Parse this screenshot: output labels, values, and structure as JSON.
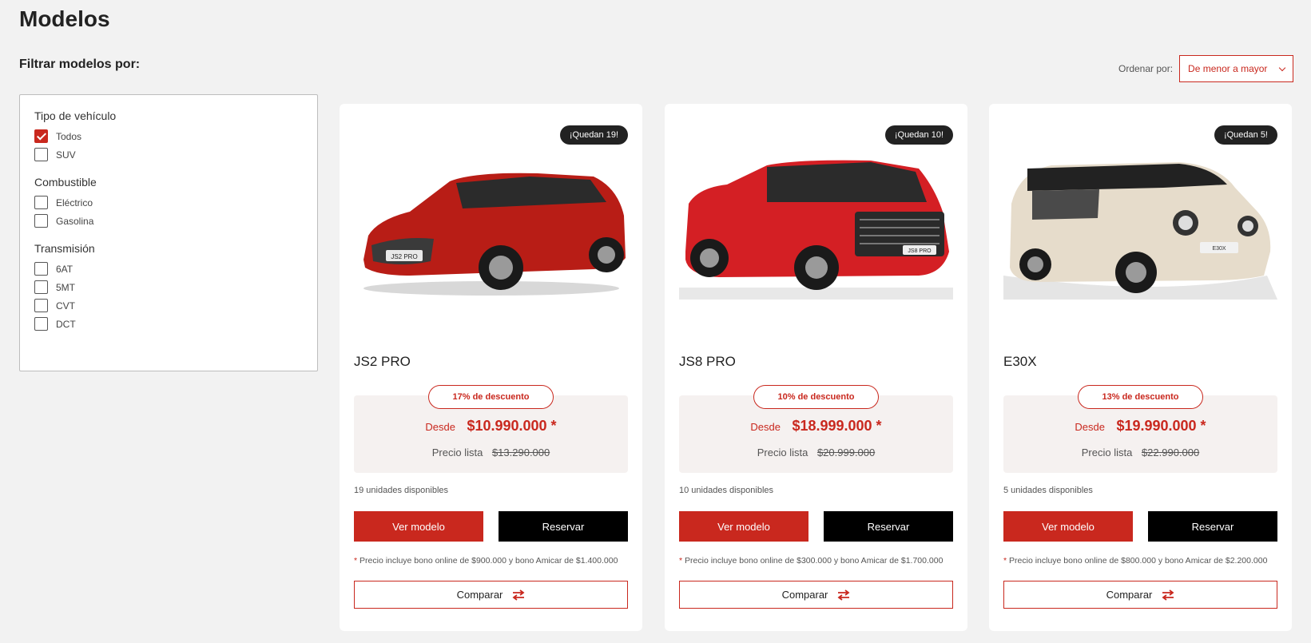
{
  "page": {
    "title": "Modelos",
    "filter_title": "Filtrar modelos por:"
  },
  "sort": {
    "label": "Ordenar por:",
    "value": "De menor a mayor"
  },
  "filters": [
    {
      "title": "Tipo de vehículo",
      "options": [
        {
          "label": "Todos",
          "checked": true
        },
        {
          "label": "SUV",
          "checked": false
        }
      ]
    },
    {
      "title": "Combustible",
      "options": [
        {
          "label": "Eléctrico",
          "checked": false
        },
        {
          "label": "Gasolina",
          "checked": false
        }
      ]
    },
    {
      "title": "Transmisión",
      "options": [
        {
          "label": "6AT",
          "checked": false
        },
        {
          "label": "5MT",
          "checked": false
        },
        {
          "label": "CVT",
          "checked": false
        },
        {
          "label": "DCT",
          "checked": false
        }
      ]
    }
  ],
  "cards": [
    {
      "badge": "¡Quedan 19!",
      "name": "JS2 PRO",
      "discount": "17% de descuento",
      "desde": "Desde",
      "price": "$10.990.000 *",
      "lista_label": "Precio lista",
      "lista": "$13.290.000",
      "units": "19 unidades disponibles",
      "ver": "Ver modelo",
      "reservar": "Reservar",
      "note": "Precio incluye bono online de $900.000 y bono Amicar de $1.400.000",
      "compare": "Comparar",
      "plate": "JS2 PRO"
    },
    {
      "badge": "¡Quedan 10!",
      "name": "JS8 PRO",
      "discount": "10% de descuento",
      "desde": "Desde",
      "price": "$18.999.000 *",
      "lista_label": "Precio lista",
      "lista": "$20.999.000",
      "units": "10 unidades disponibles",
      "ver": "Ver modelo",
      "reservar": "Reservar",
      "note": "Precio incluye bono online de $300.000 y bono Amicar de $1.700.000",
      "compare": "Comparar",
      "plate": "JS8 PRO"
    },
    {
      "badge": "¡Quedan 5!",
      "name": "E30X",
      "discount": "13% de descuento",
      "desde": "Desde",
      "price": "$19.990.000 *",
      "lista_label": "Precio lista",
      "lista": "$22.990.000",
      "units": "5 unidades disponibles",
      "ver": "Ver modelo",
      "reservar": "Reservar",
      "note": "Precio incluye bono online de $800.000 y bono Amicar de $2.200.000",
      "compare": "Comparar",
      "plate": "E30X"
    }
  ],
  "note_asterisk": "*",
  "colors": {
    "accent": "#c9281e",
    "card1_car": "#b81d16",
    "card2_car": "#d41f24",
    "card3_car": "#e6dccb"
  },
  "icons": {
    "check": "check-icon",
    "chevron": "chevron-down-icon",
    "compare": "swap-arrows-icon"
  }
}
